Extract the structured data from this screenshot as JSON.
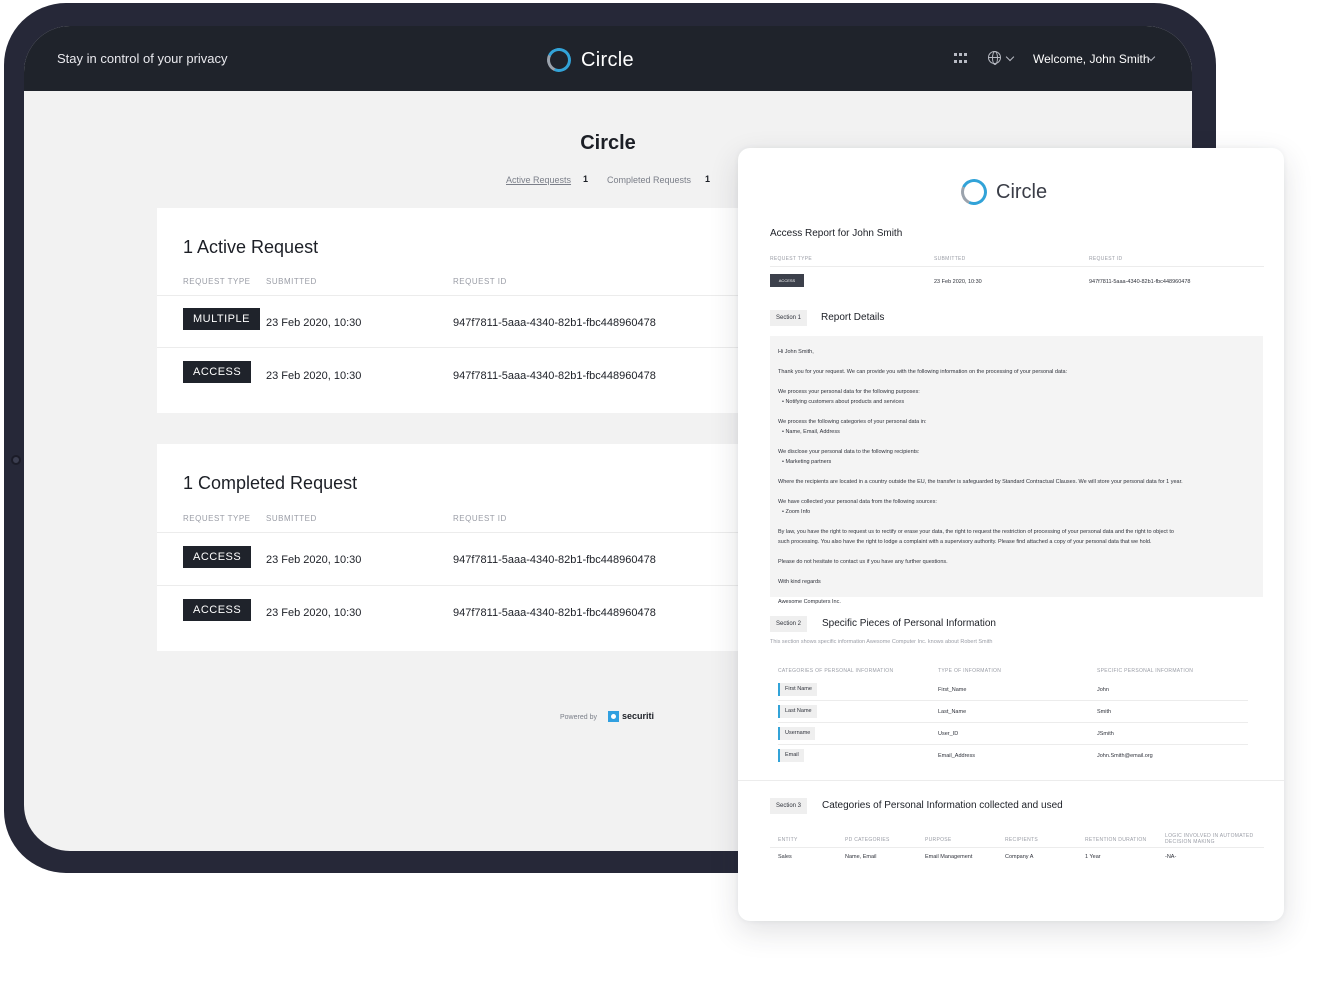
{
  "app": {
    "tagline": "Stay in control of your privacy",
    "brand": "Circle",
    "welcome": "Welcome, John Smith",
    "icons": [
      "apps-grid-icon",
      "globe-icon",
      "chevron-down-icon"
    ]
  },
  "main": {
    "title": "Circle",
    "tabs": [
      {
        "label": "Active Requests",
        "count": "1"
      },
      {
        "label": "Completed Requests",
        "count": "1"
      }
    ],
    "columns": [
      "REQUEST TYPE",
      "SUBMITTED",
      "REQUEST ID"
    ],
    "active": {
      "title": "1 Active Request",
      "rows": [
        {
          "type": "MULTIPLE",
          "submitted": "23 Feb 2020, 10:30",
          "id": "947f7811-5aaa-4340-82b1-fbc448960478"
        },
        {
          "type": "ACCESS",
          "submitted": "23 Feb 2020, 10:30",
          "id": "947f7811-5aaa-4340-82b1-fbc448960478"
        }
      ]
    },
    "completed": {
      "title": "1 Completed Request",
      "rows": [
        {
          "type": "ACCESS",
          "submitted": "23 Feb 2020, 10:30",
          "id": "947f7811-5aaa-4340-82b1-fbc448960478"
        },
        {
          "type": "ACCESS",
          "submitted": "23 Feb 2020, 10:30",
          "id": "947f7811-5aaa-4340-82b1-fbc448960478"
        }
      ]
    },
    "powered_by": "Powered by",
    "powered_brand": "securiti"
  },
  "report": {
    "brand": "Circle",
    "title": "Access Report for John Smith",
    "columns": [
      "REQUEST TYPE",
      "SUBMITTED",
      "REQUEST ID"
    ],
    "row": {
      "type": "ACCESS",
      "submitted": "23 Feb 2020, 10:30",
      "id": "947f7811-5aaa-4340-82b1-fbc448960478"
    },
    "section1": {
      "tag": "Section 1",
      "title": "Report Details",
      "lines": [
        "Hi John Smith,",
        "Thank you for your request. We can provide you with the following information on the processing of your personal data:",
        "We process your personal data for the following purposes:",
        "• Notifying customers about products and services",
        "We process the following categories of your personal data in:",
        "• Name, Email, Address",
        "We disclose your personal data to the following recipients:",
        "• Marketing partners",
        "Where the recipients are located in a country outside the EU, the transfer is safeguarded by Standard Contractual Clauses. We will store your personal data for 1 year.",
        "We have collected your personal data from the following sources:",
        "• Zoom Info",
        "By law, you have the right to request us to rectify or erase your data, the right to request the restriction of processing of your personal data and the right to object to",
        "such processing. You also have the right to lodge a complaint with a supervisory authority. Please find attached a copy of your personal data that we hold.",
        "Please do not hesitate to contact us if you have any further questions.",
        "With kind regards",
        "Awesome Computers Inc."
      ]
    },
    "section2": {
      "tag": "Section 2",
      "title": "Specific Pieces of Personal Information",
      "desc": "This section shows specific information Awesome Computer Inc. knows about Robert Smith",
      "columns": [
        "CATEGORIES OF PERSONAL INFORMATION",
        "TYPE OF INFORMATION",
        "SPECIFIC PERSONAL INFORMATION"
      ],
      "rows": [
        {
          "category": "First Name",
          "type": "First_Name",
          "value": "John"
        },
        {
          "category": "Last Name",
          "type": "Last_Name",
          "value": "Smith"
        },
        {
          "category": "Username",
          "type": "User_ID",
          "value": "JSmith"
        },
        {
          "category": "Email",
          "type": "Email_Address",
          "value": "John.Smith@email.org"
        }
      ]
    },
    "section3": {
      "tag": "Section 3",
      "title": "Categories of Personal Information collected and used",
      "columns": [
        "ENTITY",
        "PD CATEGORIES",
        "PURPOSE",
        "RECIPIENTS",
        "RETENTION DURATION",
        "LOGIC INVOLVED IN AUTOMATED DECISION MAKING"
      ],
      "row": [
        "Sales",
        "Name, Email",
        "Email Management",
        "Company A",
        "1 Year",
        "-NA-"
      ]
    }
  },
  "colors": {
    "topbar": "#1f232b",
    "accent": "#32a3d8",
    "frame": "#262838",
    "badge": "#1f232b"
  }
}
